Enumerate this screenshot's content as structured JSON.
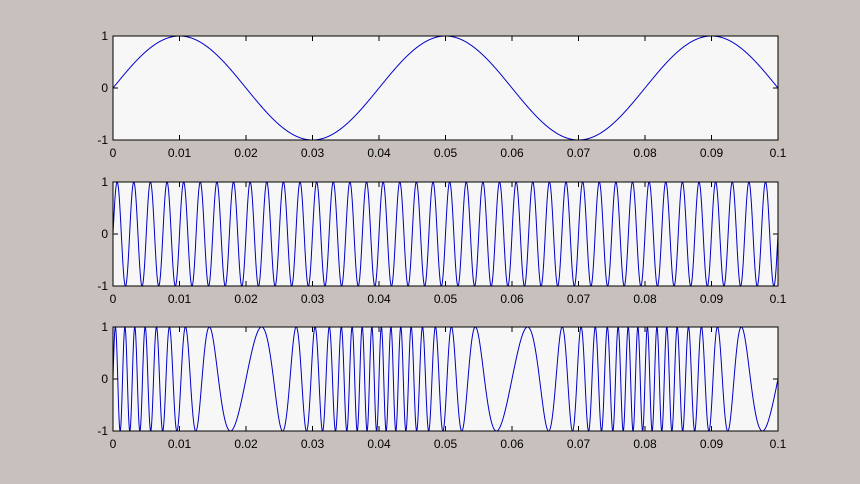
{
  "figure": {
    "background": "#c8c0bc",
    "axes_background": "#f7f7f7",
    "line_color": "#0000c8"
  },
  "chart_data": [
    {
      "type": "line",
      "title": "",
      "xlabel": "",
      "ylabel": "",
      "xlim": [
        0,
        0.1
      ],
      "ylim": [
        -1,
        1
      ],
      "x_ticks": [
        0,
        0.01,
        0.02,
        0.03,
        0.04,
        0.05,
        0.06,
        0.07,
        0.08,
        0.09,
        0.1
      ],
      "x_tick_labels": [
        "0",
        "0.01",
        "0.02",
        "0.03",
        "0.04",
        "0.05",
        "0.06",
        "0.07",
        "0.08",
        "0.09",
        "0.1"
      ],
      "y_ticks": [
        -1,
        0,
        1
      ],
      "y_tick_labels": [
        "-1",
        "0",
        "1"
      ],
      "grid": false,
      "series": [
        {
          "function": "sin",
          "amplitude": 1,
          "frequency_hz": 25,
          "x_start": 0,
          "x_end": 0.1
        }
      ]
    },
    {
      "type": "line",
      "title": "",
      "xlabel": "",
      "ylabel": "",
      "xlim": [
        0,
        0.1
      ],
      "ylim": [
        -1,
        1
      ],
      "x_ticks": [
        0,
        0.01,
        0.02,
        0.03,
        0.04,
        0.05,
        0.06,
        0.07,
        0.08,
        0.09,
        0.1
      ],
      "x_tick_labels": [
        "0",
        "0.01",
        "0.02",
        "0.03",
        "0.04",
        "0.05",
        "0.06",
        "0.07",
        "0.08",
        "0.09",
        "0.1"
      ],
      "y_ticks": [
        -1,
        0,
        1
      ],
      "y_tick_labels": [
        "-1",
        "0",
        "1"
      ],
      "grid": false,
      "series": [
        {
          "function": "sin",
          "amplitude": 1,
          "frequency_hz": 400,
          "x_start": 0,
          "x_end": 0.1
        }
      ]
    },
    {
      "type": "line",
      "title": "",
      "xlabel": "",
      "ylabel": "",
      "xlim": [
        0,
        0.1
      ],
      "ylim": [
        -1,
        1
      ],
      "x_ticks": [
        0,
        0.01,
        0.02,
        0.03,
        0.04,
        0.05,
        0.06,
        0.07,
        0.08,
        0.09,
        0.1
      ],
      "x_tick_labels": [
        "0",
        "0.01",
        "0.02",
        "0.03",
        "0.04",
        "0.05",
        "0.06",
        "0.07",
        "0.08",
        "0.09",
        "0.1"
      ],
      "y_ticks": [
        -1,
        0,
        1
      ],
      "y_tick_labels": [
        "-1",
        "0",
        "1"
      ],
      "grid": false,
      "series": [
        {
          "function": "fm",
          "amplitude": 1,
          "carrier_hz": 400,
          "modulator_hz": 25,
          "modulation_index": 12,
          "x_start": 0,
          "x_end": 0.1
        }
      ]
    }
  ]
}
